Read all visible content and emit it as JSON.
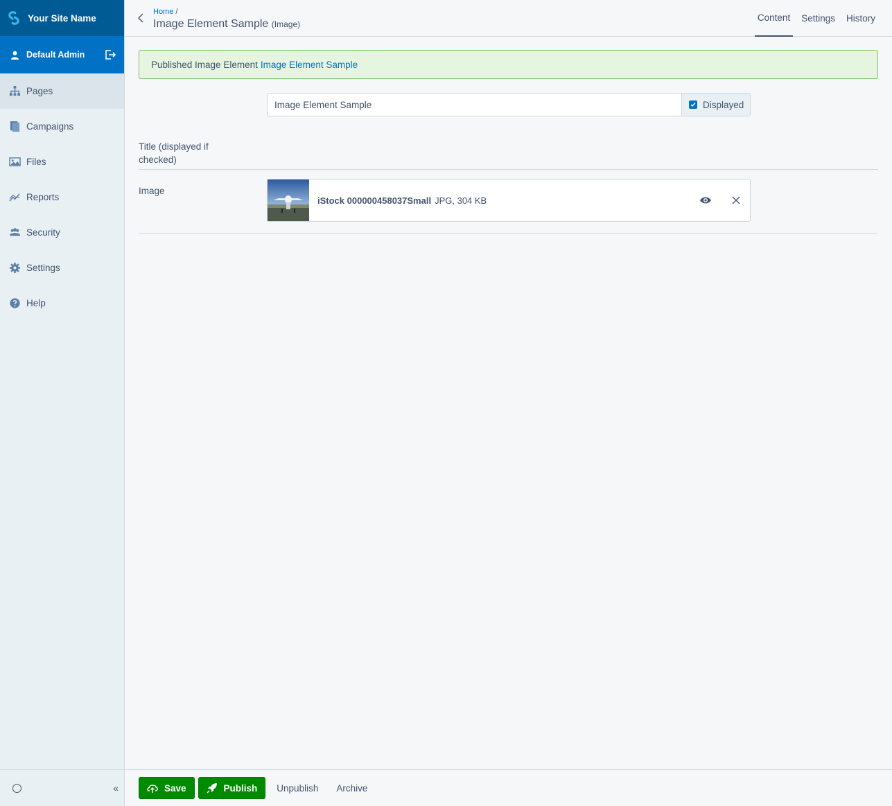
{
  "brand": {
    "site_name": "Your Site Name"
  },
  "user": {
    "name": "Default Admin"
  },
  "nav": {
    "items": [
      {
        "label": "Pages",
        "icon": "sitemap-icon"
      },
      {
        "label": "Campaigns",
        "icon": "campaigns-icon"
      },
      {
        "label": "Files",
        "icon": "image-icon"
      },
      {
        "label": "Reports",
        "icon": "chart-line-icon"
      },
      {
        "label": "Security",
        "icon": "users-icon"
      },
      {
        "label": "Settings",
        "icon": "gear-icon"
      },
      {
        "label": "Help",
        "icon": "help-icon"
      }
    ],
    "collapse_label": "«"
  },
  "header": {
    "breadcrumb_home": "Home",
    "breadcrumb_sep": "/",
    "title": "Image Element Sample",
    "type": "(Image)",
    "tabs": [
      "Content",
      "Settings",
      "History"
    ]
  },
  "alert": {
    "text": "Published Image Element",
    "link": "Image Element Sample"
  },
  "form": {
    "title_label": "Title (displayed if checked)",
    "title_value": "Image Element Sample",
    "displayed_label": "Displayed",
    "image_label": "Image",
    "file_name": "iStock 000000458037Small",
    "file_meta": "JPG, 304 KB"
  },
  "actions": {
    "save": "Save",
    "publish": "Publish",
    "unpublish": "Unpublish",
    "archive": "Archive"
  },
  "colors": {
    "brand_dark": "#005a93",
    "brand": "#0071c4",
    "success": "#008a00"
  }
}
